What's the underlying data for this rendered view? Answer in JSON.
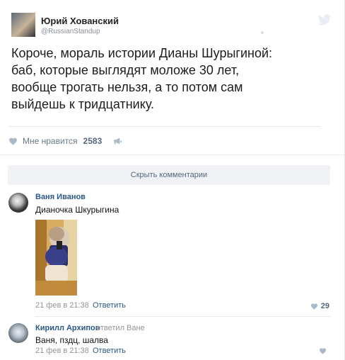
{
  "tweet": {
    "author_name": "Юрий Хованский",
    "author_handle": "@RussianStandup",
    "text_lines": [
      "Короче, мораль истории Дианы Шурыгиной:",
      "баб, которые выглядят моложе 30 лет,",
      "вообще трогать нельзя, а то потом сам",
      "выйдешь к тридцатнику."
    ],
    "icons": {
      "logo": "twitter-bird-icon"
    }
  },
  "post_actions": {
    "like_label": "Мне нравится",
    "like_count": "2583",
    "icons": {
      "like": "heart-icon",
      "share": "megaphone-icon"
    }
  },
  "hide_comments_label": "Скрыть комментарии",
  "comments": [
    {
      "author": "Ваня Иванов",
      "text": "Дианочка Шкурыгина",
      "date": "21 фев в 21:38",
      "reply_label": "Ответить",
      "likes": "29"
    },
    {
      "author": "Кирилл Архипов",
      "replied_to": "ответил Ване",
      "text": "Ваня, пздц, шалва",
      "date": "21 фев в 21:38",
      "reply_label": "Ответить",
      "likes": ""
    }
  ],
  "colors": {
    "link": "#2a5885",
    "muted": "#939393",
    "divider": "#e7e8ec",
    "button_bg": "#f0f2f5",
    "icon": "#adb8c6"
  }
}
